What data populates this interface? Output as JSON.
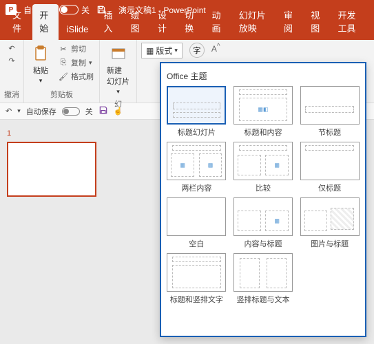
{
  "title_bar": {
    "autosave_label": "自动保存",
    "autosave_state": "关",
    "doc_title": "演示文稿1 - PowerPoint"
  },
  "tabs": {
    "file": "文件",
    "items": [
      "开始",
      "iSlide",
      "插入",
      "绘图",
      "设计",
      "切换",
      "动画",
      "幻灯片放映",
      "审阅",
      "视图",
      "开发工具"
    ],
    "active_index": 0
  },
  "ribbon": {
    "undo_group_label": "撤消",
    "clipboard": {
      "paste_label": "粘贴",
      "cut_label": "剪切",
      "copy_label": "复制",
      "format_painter_label": "格式刷",
      "group_label": "剪贴板"
    },
    "slides": {
      "new_slide_label": "新建\n幻灯片",
      "layout_label": "版式",
      "group_label": "幻"
    },
    "font_placeholder": "Aa",
    "font_button": "字"
  },
  "qat": {
    "autosave_label": "自动保存",
    "autosave_state": "关"
  },
  "thumbnails": {
    "slide_number": "1"
  },
  "layout_popup": {
    "title": "Office 主题",
    "items": [
      {
        "label": "标题幻灯片",
        "kind": "title",
        "selected": true
      },
      {
        "label": "标题和内容",
        "kind": "title-content"
      },
      {
        "label": "节标题",
        "kind": "section"
      },
      {
        "label": "两栏内容",
        "kind": "two-content"
      },
      {
        "label": "比较",
        "kind": "compare"
      },
      {
        "label": "仅标题",
        "kind": "title-only"
      },
      {
        "label": "空白",
        "kind": "blank"
      },
      {
        "label": "内容与标题",
        "kind": "content-caption"
      },
      {
        "label": "图片与标题",
        "kind": "pic-caption"
      },
      {
        "label": "标题和竖排文字",
        "kind": "title-vert"
      },
      {
        "label": "竖排标题与文本",
        "kind": "vert-title-text"
      }
    ]
  }
}
